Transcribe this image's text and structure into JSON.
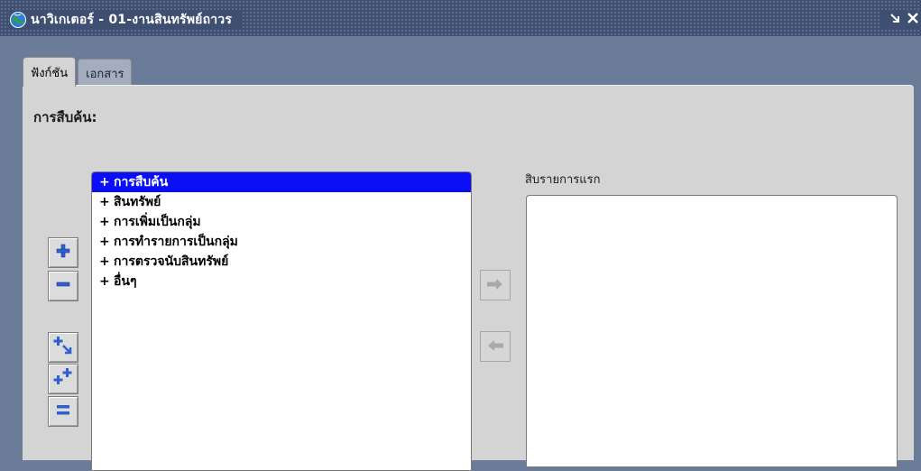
{
  "window": {
    "title": "นาวิเกเตอร์ - 01-งานสินทรัพย์ถาวร",
    "icon": "navigator-globe-icon",
    "controls": [
      "minimize-icon",
      "close-icon"
    ]
  },
  "tabs": [
    {
      "label": "ฟังก์ชัน",
      "active": true
    },
    {
      "label": "เอกสาร",
      "active": false
    }
  ],
  "main": {
    "section_label": "การสืบค้น:",
    "tree": {
      "items": [
        {
          "prefix": "+",
          "label": "การสืบค้น",
          "selected": true
        },
        {
          "prefix": "+",
          "label": "สินทรัพย์",
          "selected": false
        },
        {
          "prefix": "+",
          "label": "การเพิ่มเป็นกลุ่ม",
          "selected": false
        },
        {
          "prefix": "+",
          "label": "การทำรายการเป็นกลุ่ม",
          "selected": false
        },
        {
          "prefix": "+",
          "label": "การตรวจนับสินทรัพย์",
          "selected": false
        },
        {
          "prefix": "+",
          "label": "อื่นๆ",
          "selected": false
        }
      ]
    },
    "side_buttons": [
      "expand-plus-icon",
      "collapse-minus-icon",
      "expand-branch-icon",
      "expand-all-icon",
      "collapse-all-icon"
    ],
    "transfer_buttons": [
      "add-right-arrow-icon",
      "remove-left-arrow-icon"
    ],
    "list_label": "สิบรายการแรก",
    "list_items": []
  },
  "colors": {
    "titlebar": "#3f4f72",
    "background": "#6b7c99",
    "panel": "#d4d4d4",
    "selection": "#0a0ff5",
    "button_blue": "#2f5fd0"
  }
}
